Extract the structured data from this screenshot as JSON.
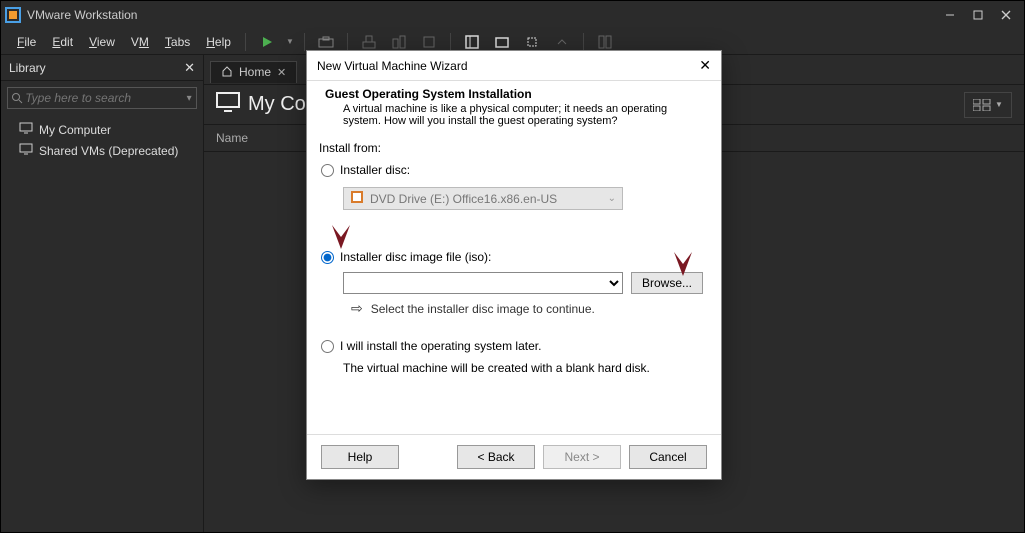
{
  "title": "VMware Workstation",
  "menu": {
    "file": "File",
    "edit": "Edit",
    "view": "View",
    "vm": "VM",
    "tabs": "Tabs",
    "help": "Help"
  },
  "library": {
    "title": "Library",
    "search_placeholder": "Type here to search",
    "items": [
      {
        "label": "My Computer"
      },
      {
        "label": "Shared VMs (Deprecated)"
      }
    ]
  },
  "tabs": [
    {
      "label": "Home"
    }
  ],
  "main": {
    "title": "My Co",
    "col0": "Name"
  },
  "dialog": {
    "title": "New Virtual Machine Wizard",
    "head": "Guest Operating System Installation",
    "sub": "A virtual machine is like a physical computer; it needs an operating system. How will you install the guest operating system?",
    "install_from": "Install from:",
    "opt_disc": "Installer disc:",
    "disc_value": "DVD Drive (E:) Office16.x86.en-US",
    "opt_iso": "Installer disc image file (iso):",
    "iso_value": "",
    "browse": "Browse...",
    "iso_hint": "Select the installer disc image to continue.",
    "opt_later": "I will install the operating system later.",
    "later_sub": "The virtual machine will be created with a blank hard disk.",
    "help": "Help",
    "back": "< Back",
    "next": "Next >",
    "cancel": "Cancel"
  }
}
